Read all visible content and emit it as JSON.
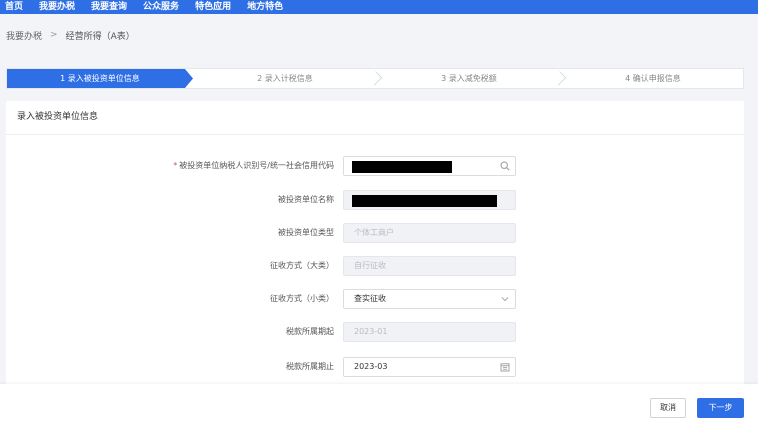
{
  "topnav": {
    "items": [
      "首页",
      "我要办税",
      "我要查询",
      "公众服务",
      "特色应用",
      "地方特色"
    ]
  },
  "breadcrumb": {
    "root": "我要办税",
    "separator": ">",
    "current": "经营所得（A表）"
  },
  "steps": [
    {
      "label": "1  录入被投资单位信息",
      "active": true
    },
    {
      "label": "2  录入计税信息",
      "active": false
    },
    {
      "label": "3  录入减免税额",
      "active": false
    },
    {
      "label": "4  确认申报信息",
      "active": false
    }
  ],
  "panel": {
    "title": "录入被投资单位信息"
  },
  "form": {
    "credit_code": {
      "label": "被投资单位纳税人识别号/统一社会信用代码",
      "required_mark": "*"
    },
    "unit_name": {
      "label": "被投资单位名称"
    },
    "unit_type": {
      "label": "被投资单位类型",
      "value": "个体工商户"
    },
    "levy_method_major": {
      "label": "征收方式（大类）",
      "value": "自行征收"
    },
    "levy_method_minor": {
      "label": "征收方式（小类）",
      "value": "查实征收"
    },
    "period_start": {
      "label": "税款所属期起",
      "value": "2023-01"
    },
    "period_end": {
      "label": "税款所属期止",
      "value": "2023-03"
    }
  },
  "footer": {
    "cancel_label": "取消",
    "next_label": "下一步"
  },
  "colors": {
    "primary": "#2f6fe6",
    "required": "#e34d4d"
  }
}
